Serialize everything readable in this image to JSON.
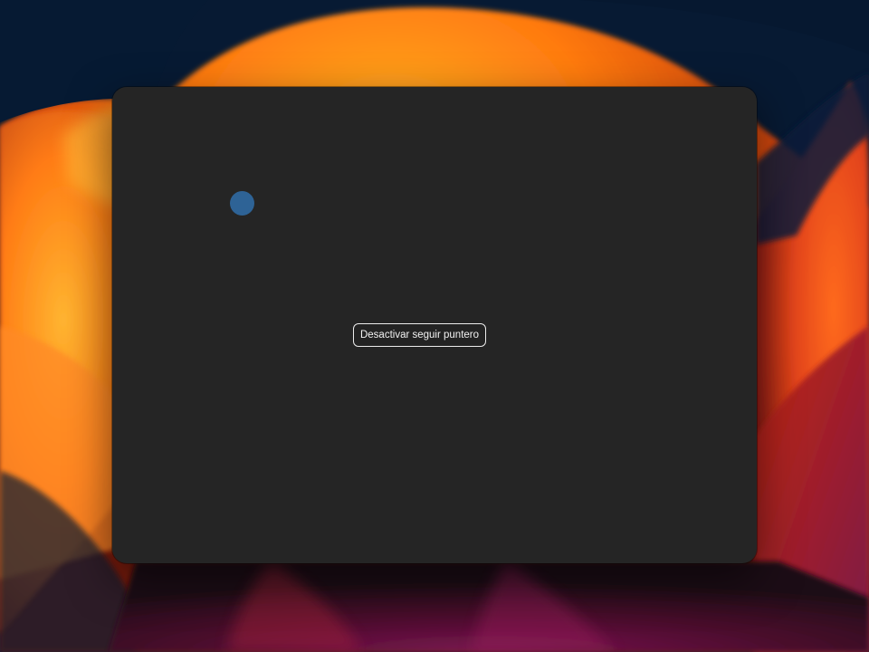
{
  "desktop": {
    "wallpaper": "orange-gradient-wallpaper"
  },
  "app_window": {
    "background_color": "#252525",
    "dot_color": "#2e6396",
    "toggle_button_label": "Desactivar seguir puntero"
  }
}
